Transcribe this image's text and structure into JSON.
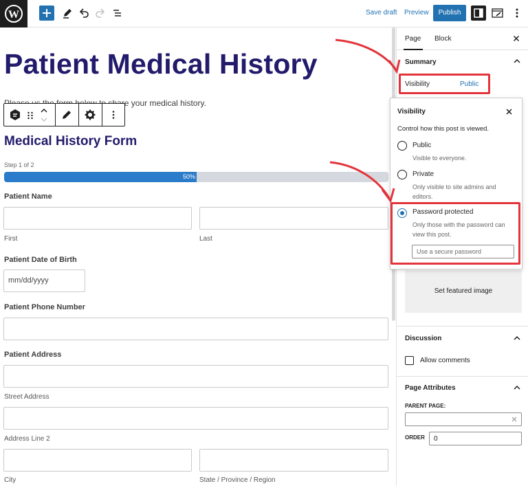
{
  "topbar": {
    "save_draft": "Save draft",
    "preview": "Preview",
    "publish": "Publish"
  },
  "editor": {
    "title": "Patient Medical History",
    "intro": "Please us the form below to share your medical history.",
    "form_title": "Medical History Form",
    "step": "Step 1 of 2",
    "progress_percent": 50,
    "progress_label": "50%",
    "fields": {
      "patient_name": "Patient Name",
      "first": "First",
      "last": "Last",
      "dob": "Patient Date of Birth",
      "dob_placeholder": "mm/dd/yyyy",
      "phone": "Patient Phone Number",
      "address": "Patient Address",
      "street": "Street Address",
      "line2": "Address Line 2",
      "city": "City",
      "state": "State / Province / Region"
    }
  },
  "sidebar": {
    "tabs": [
      "Page",
      "Block"
    ],
    "summary": "Summary",
    "visibility_label": "Visibility",
    "visibility_value": "Public",
    "featured_image": "Set featured image",
    "discussion": "Discussion",
    "allow_comments": "Allow comments",
    "page_attributes": "Page Attributes",
    "parent_page": "PARENT PAGE:",
    "order_label": "ORDER",
    "order_value": "0"
  },
  "popover": {
    "title": "Visibility",
    "description": "Control how this post is viewed.",
    "options": [
      {
        "label": "Public",
        "help": "Visible to everyone.",
        "selected": false
      },
      {
        "label": "Private",
        "help": "Only visible to site admins and editors.",
        "selected": false
      },
      {
        "label": "Password protected",
        "help": "Only those with the password can view this post.",
        "selected": true
      }
    ],
    "password_placeholder": "Use a secure password"
  },
  "colors": {
    "accent": "#2271b1",
    "title": "#221b6b",
    "annotation": "#e3343c",
    "progress": "#2a7bc9"
  }
}
